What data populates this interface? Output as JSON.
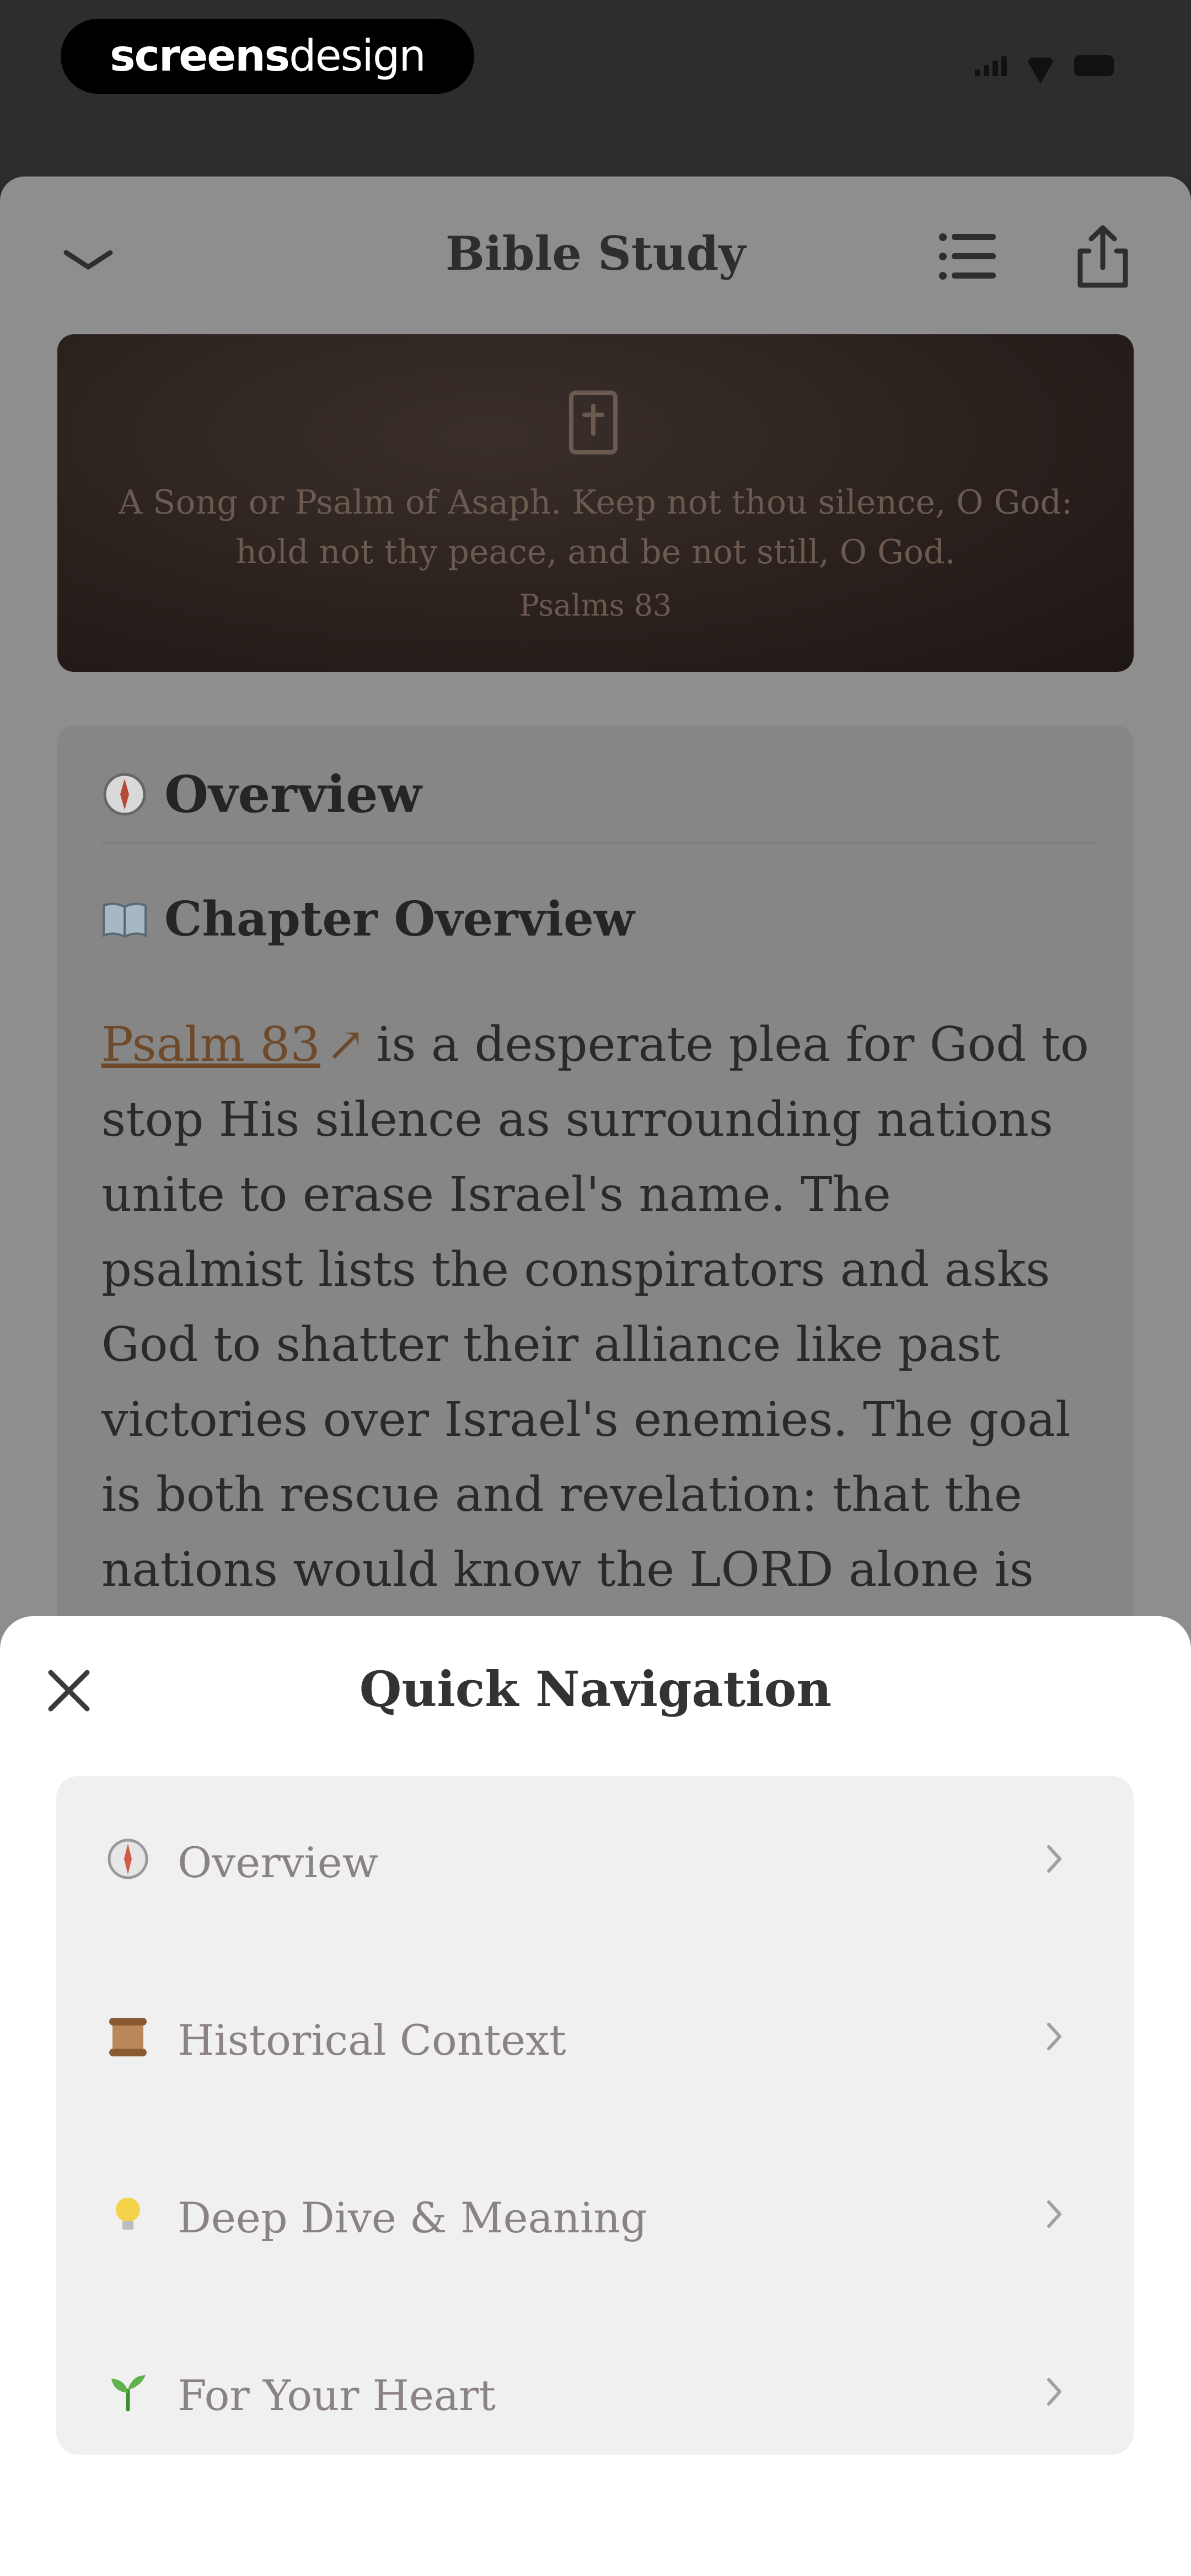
{
  "status_bar": {
    "brand_bold": "screens",
    "brand_light": "design"
  },
  "screen": {
    "title": "Bible Study"
  },
  "banner": {
    "quote": "A Song or Psalm of Asaph. Keep not thou silence, O God: hold not thy peace, and be not still, O God.",
    "reference": "Psalms 83"
  },
  "overview_card": {
    "heading": "Overview",
    "subheading": "Chapter Overview",
    "link_text": "Psalm 83",
    "body": "is a desperate plea for God to stop His silence as surrounding nations unite to erase Israel's name. The psalmist lists the conspirators and asks God to shatter their alliance like past victories over Israel's enemies. The goal is both rescue and revelation: that the nations would know the LORD alone is Most High."
  },
  "modal": {
    "title": "Quick Navigation",
    "items": [
      {
        "label": "Overview",
        "icon": "compass-icon"
      },
      {
        "label": "Historical Context",
        "icon": "scroll-icon"
      },
      {
        "label": "Deep Dive & Meaning",
        "icon": "lightbulb-icon"
      },
      {
        "label": "For Your Heart",
        "icon": "seedling-icon"
      }
    ]
  },
  "colors": {
    "accent_link": "#6e4a2a",
    "banner_bg": "#2a211d",
    "modal_bg": "#ffffff",
    "nav_card_bg": "#f1f0f0"
  }
}
